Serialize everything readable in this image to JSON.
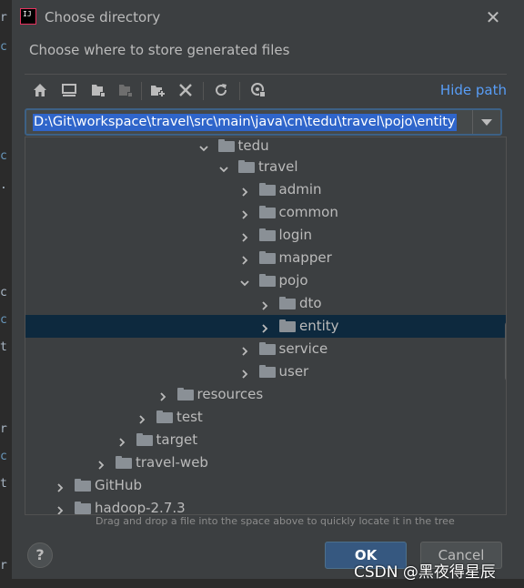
{
  "dialog": {
    "title": "Choose directory",
    "subtitle": "Choose where to store generated files"
  },
  "toolbar": {
    "buttons": [
      "home-icon",
      "desktop-icon",
      "project-folder-icon",
      "module-folder-icon",
      "new-folder-icon",
      "delete-icon",
      "refresh-icon",
      "show-hidden-icon"
    ],
    "hide_path_label": "Hide path"
  },
  "path": {
    "value": "D:\\Git\\workspace\\travel\\src\\main\\java\\cn\\tedu\\travel\\pojo\\entity"
  },
  "tree": {
    "rows": [
      {
        "label": "tedu",
        "expanded": true,
        "selected": false
      },
      {
        "label": "travel",
        "expanded": true,
        "selected": false
      },
      {
        "label": "admin",
        "expanded": false,
        "selected": false
      },
      {
        "label": "common",
        "expanded": false,
        "selected": false
      },
      {
        "label": "login",
        "expanded": false,
        "selected": false
      },
      {
        "label": "mapper",
        "expanded": false,
        "selected": false
      },
      {
        "label": "pojo",
        "expanded": true,
        "selected": false
      },
      {
        "label": "dto",
        "expanded": false,
        "selected": false
      },
      {
        "label": "entity",
        "expanded": false,
        "selected": true
      },
      {
        "label": "service",
        "expanded": false,
        "selected": false
      },
      {
        "label": "user",
        "expanded": false,
        "selected": false
      },
      {
        "label": "resources",
        "expanded": false,
        "selected": false
      },
      {
        "label": "test",
        "expanded": false,
        "selected": false
      },
      {
        "label": "target",
        "expanded": false,
        "selected": false
      },
      {
        "label": "travel-web",
        "expanded": false,
        "selected": false
      },
      {
        "label": "GitHub",
        "expanded": false,
        "selected": false
      },
      {
        "label": "hadoop-2.7.3",
        "expanded": false,
        "selected": false
      }
    ]
  },
  "hint": "Drag and drop a file into the space above to quickly locate it in the tree",
  "buttons": {
    "help_label": "?",
    "ok_label": "OK",
    "cancel_label": "Cancel"
  },
  "watermark": "CSDN @黑夜得星辰",
  "colors": {
    "dialog_bg": "#3c3f41",
    "accent": "#589df6",
    "selection": "#2f65ca",
    "selected_row": "#0d293e",
    "ok_button": "#365880"
  }
}
